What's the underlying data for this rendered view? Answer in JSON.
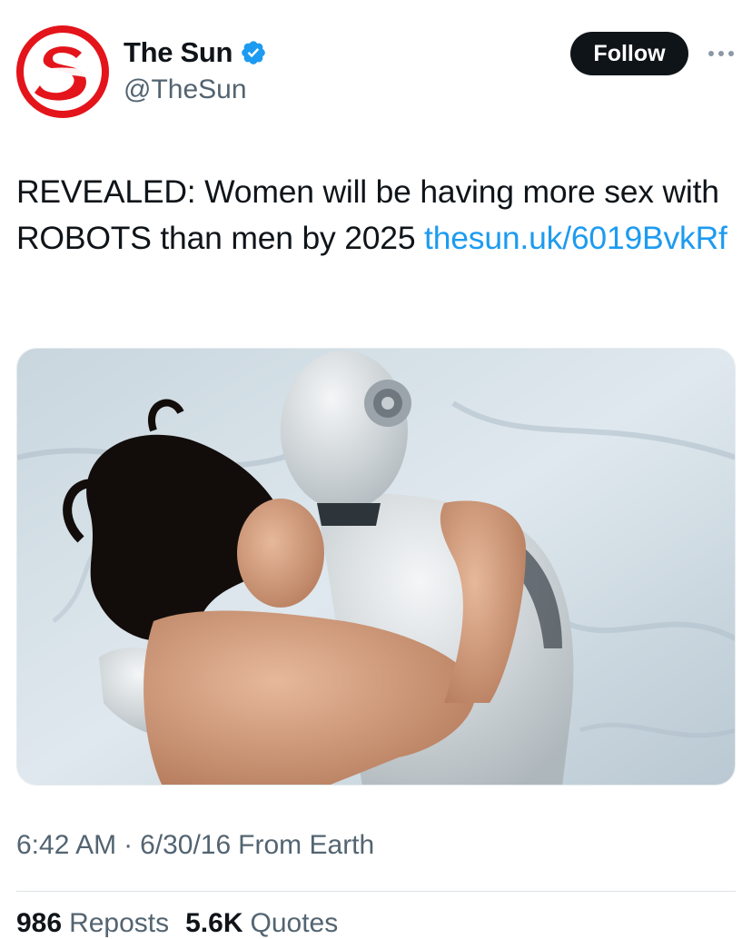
{
  "account": {
    "display_name": "The Sun",
    "handle": "@TheSun",
    "verified": true
  },
  "header": {
    "follow_label": "Follow"
  },
  "tweet": {
    "text": "REVEALED: Women will be having more sex with ROBOTS than men by 2025 ",
    "link_text": "thesun.uk/​6019BvkRf"
  },
  "meta": {
    "time": "6:42 AM",
    "separator": "·",
    "date": "6/30/16",
    "source": "From Earth"
  },
  "stats": {
    "reposts_count": "986",
    "reposts_label": "Reposts",
    "quotes_count": "5.6K",
    "quotes_label": "Quotes"
  },
  "colors": {
    "brand_red": "#e4141b",
    "link_blue": "#1d9bf0",
    "verified_blue": "#1d9bf0",
    "text_primary": "#0f1419",
    "text_secondary": "#536471",
    "follow_bg": "#0f1419"
  },
  "icons": {
    "avatar": "the-sun-logo",
    "verified": "verified-badge-icon",
    "more": "more-dots-icon"
  }
}
